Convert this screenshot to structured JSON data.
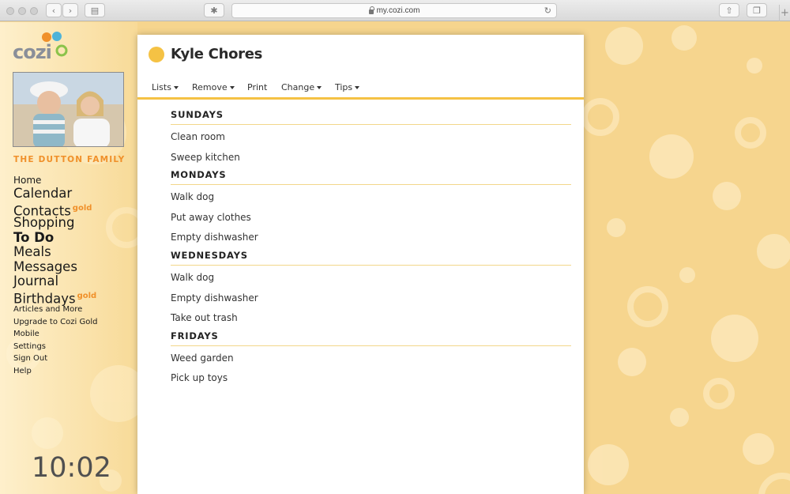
{
  "browser": {
    "url": "my.cozi.com",
    "icons": [
      "back-icon",
      "forward-icon",
      "sidebar-icon",
      "extension-icon",
      "lock-icon",
      "reload-icon",
      "share-icon",
      "tabs-icon",
      "new-tab-icon"
    ]
  },
  "sidebar": {
    "logo_text": "cozi",
    "family_name": "THE DUTTON FAMILY",
    "gold_label": "gold",
    "nav": {
      "home": "Home",
      "calendar": "Calendar",
      "contacts": "Contacts",
      "shopping": "Shopping",
      "todo": "To Do",
      "meals": "Meals",
      "messages": "Messages",
      "journal": "Journal",
      "birthdays": "Birthdays",
      "articles": "Articles and More",
      "upgrade": "Upgrade to Cozi Gold",
      "mobile": "Mobile",
      "settings": "Settings",
      "signout": "Sign Out",
      "help": "Help"
    },
    "clock": "10:02"
  },
  "panel": {
    "title": "Kyle Chores",
    "title_color": "#f5c244",
    "toolbar": {
      "lists": "Lists",
      "remove": "Remove",
      "print": "Print",
      "change": "Change",
      "tips": "Tips"
    },
    "sections": [
      {
        "heading": "SUNDAYS",
        "items": [
          "Clean room",
          "Sweep kitchen"
        ]
      },
      {
        "heading": "MONDAYS",
        "items": [
          "Walk dog",
          "Put away clothes",
          "Empty dishwasher"
        ]
      },
      {
        "heading": "WEDNESDAYS",
        "items": [
          "Walk dog",
          "Empty dishwasher",
          "Take out trash"
        ]
      },
      {
        "heading": "FRIDAYS",
        "items": [
          "Weed garden",
          "Pick up toys"
        ]
      }
    ]
  },
  "colors": {
    "accent": "#f5c244",
    "orange": "#f0902a",
    "background": "#f6d58e"
  }
}
